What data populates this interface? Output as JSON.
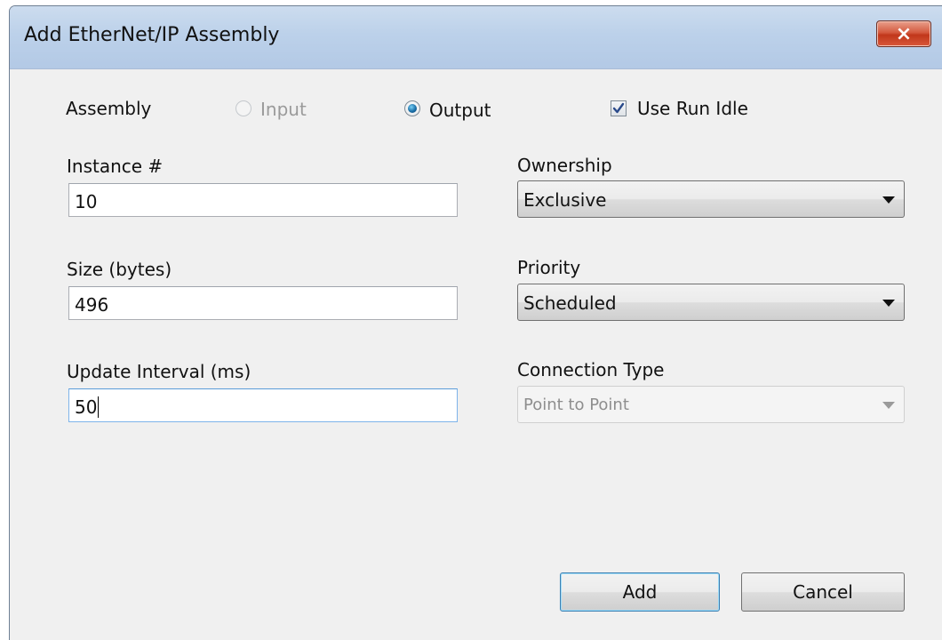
{
  "window": {
    "title": "Add EtherNet/IP Assembly",
    "close_glyph": "×"
  },
  "assembly": {
    "label": "Assembly",
    "input_label": "Input",
    "output_label": "Output",
    "selected": "Output",
    "input_enabled": false,
    "use_run_idle_label": "Use Run Idle",
    "use_run_idle_checked": true
  },
  "fields": {
    "instance_label": "Instance #",
    "instance_value": "10",
    "size_label": "Size (bytes)",
    "size_value": "496",
    "interval_label": "Update Interval (ms)",
    "interval_value": "50"
  },
  "dropdowns": {
    "ownership_label": "Ownership",
    "ownership_value": "Exclusive",
    "priority_label": "Priority",
    "priority_value": "Scheduled",
    "connection_type_label": "Connection Type",
    "connection_type_value": "Point to Point",
    "connection_type_enabled": false
  },
  "buttons": {
    "add": "Add",
    "cancel": "Cancel"
  },
  "icons": {
    "close": "close-icon",
    "check": "checkmark-icon",
    "dropdown": "chevron-down-icon"
  },
  "colors": {
    "title_bar": "#bcd1ea",
    "close_button": "#c7402a",
    "radio_selected": "#1a6fa8",
    "focus_border": "#7eb4ea"
  }
}
